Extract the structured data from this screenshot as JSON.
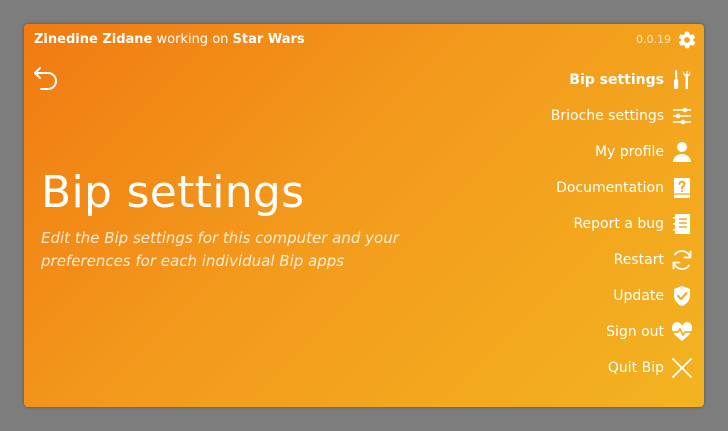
{
  "header": {
    "user": "Zinedine Zidane",
    "working_on": "working on",
    "project": "Star Wars",
    "version": "0.0.19"
  },
  "page": {
    "title": "Bip settings",
    "description": "Edit the Bip settings for this computer and your preferences for each individual Bip apps"
  },
  "menu": {
    "items": [
      {
        "label": "Bip settings",
        "icon": "tools-icon",
        "active": true
      },
      {
        "label": "Brioche settings",
        "icon": "sliders-icon",
        "active": false
      },
      {
        "label": "My profile",
        "icon": "user-icon",
        "active": false
      },
      {
        "label": "Documentation",
        "icon": "help-book-icon",
        "active": false
      },
      {
        "label": "Report a bug",
        "icon": "notebook-icon",
        "active": false
      },
      {
        "label": "Restart",
        "icon": "refresh-icon",
        "active": false
      },
      {
        "label": "Update",
        "icon": "shield-check-icon",
        "active": false
      },
      {
        "label": "Sign out",
        "icon": "heartbeat-icon",
        "active": false
      },
      {
        "label": "Quit Bip",
        "icon": "close-icon",
        "active": false
      }
    ]
  },
  "colors": {
    "background": "#7d7d7d",
    "gradient_start": "#f17a12",
    "gradient_end": "#f3b320",
    "foreground": "#ffffff"
  }
}
